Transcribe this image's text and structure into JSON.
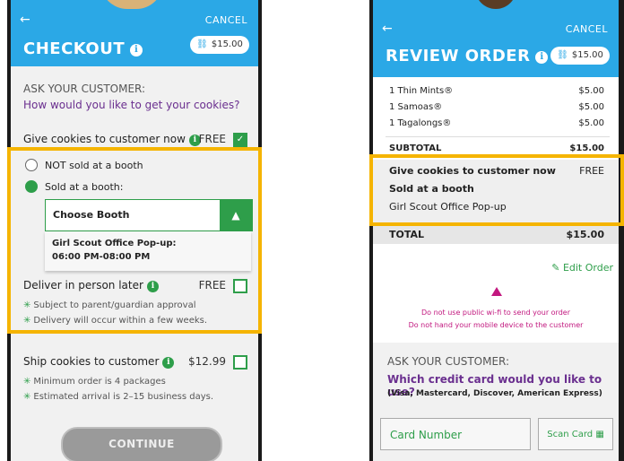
{
  "checkout": {
    "back_icon": "arrow-left-icon",
    "cancel": "CANCEL",
    "title": "CHECKOUT",
    "cart_total": "$15.00",
    "ask_label": "ASK YOUR CUSTOMER:",
    "question": "How would you like to get your cookies?",
    "give_now": {
      "label": "Give cookies to customer now",
      "price": "FREE",
      "checked": true
    },
    "not_booth": "NOT sold at a booth",
    "sold_booth": "Sold at a booth:",
    "booth_select": "Choose Booth",
    "booth_option_line1": "Girl Scout Office Pop-up:",
    "booth_option_line2": "06:00 PM-08:00 PM",
    "deliver_later": {
      "label": "Deliver in person later",
      "price": "FREE"
    },
    "deliver_notes": [
      "Subject to parent/guardian approval",
      "Delivery will occur within a few weeks."
    ],
    "ship": {
      "label": "Ship cookies to customer",
      "price": "$12.99"
    },
    "ship_notes": [
      "Minimum order is 4 packages",
      "Estimated arrival is 2–15 business days."
    ],
    "continue": "CONTINUE"
  },
  "review": {
    "back_icon": "arrow-left-icon",
    "cancel": "CANCEL",
    "title": "REVIEW ORDER",
    "cart_total": "$15.00",
    "items": [
      {
        "name": "1 Thin Mints®",
        "price": "$5.00"
      },
      {
        "name": "1 Samoas®",
        "price": "$5.00"
      },
      {
        "name": "1 Tagalongs®",
        "price": "$5.00"
      }
    ],
    "subtotal_label": "SUBTOTAL",
    "subtotal": "$15.00",
    "delivery_label": "Give cookies to customer now",
    "delivery_price": "FREE",
    "booth_line": "Sold at a booth",
    "booth_name": "Girl Scout Office Pop-up",
    "total_label": "TOTAL",
    "total": "$15.00",
    "edit_order": "Edit Order",
    "warnings": [
      "Do not use public wi-fi to send your order",
      "Do not hand your mobile device to the customer"
    ],
    "ask_label": "ASK YOUR CUSTOMER:",
    "card_question": "Which credit card would you like to use?",
    "card_types": "(Visa, Mastercard, Discover, American Express)",
    "card_placeholder": "Card Number",
    "scan_card": "Scan Card"
  },
  "colors": {
    "header": "#2ba8e6",
    "green": "#2e9e4a",
    "purple": "#6a2f8f",
    "highlight": "#f5b400",
    "warning": "#c2187f"
  }
}
